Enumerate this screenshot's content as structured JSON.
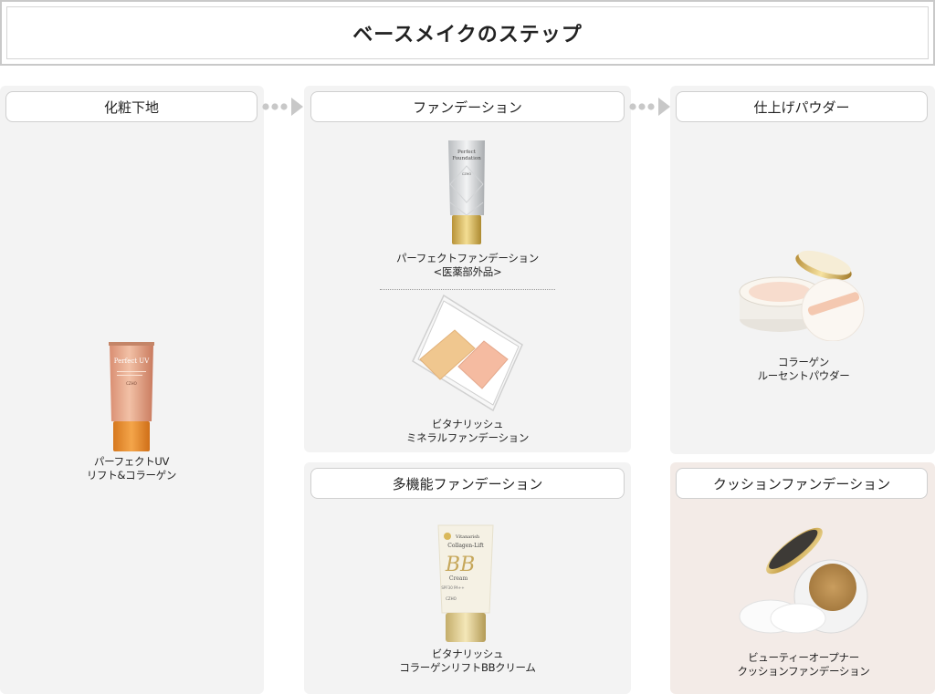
{
  "page": {
    "title": "ベースメイクのステップ"
  },
  "steps": {
    "primer": {
      "label": "化粧下地"
    },
    "foundation": {
      "label": "ファンデーション"
    },
    "powder": {
      "label": "仕上げパウダー"
    },
    "multi_foundation": {
      "label": "多機能ファンデーション"
    },
    "cushion_foundation": {
      "label": "クッションファンデーション"
    }
  },
  "products": {
    "perfect_uv": {
      "line1": "パーフェクトUV",
      "line2": "リフト&コラーゲン",
      "tube_text": "Perfect UV"
    },
    "perfect_foundation": {
      "line1": "パーフェクトファンデーション",
      "line2": "<医薬部外品>",
      "tube_text1": "Perfect",
      "tube_text2": "Foundation",
      "tube_brand": "CZHO"
    },
    "vitanarish_mineral": {
      "line1": "ビタナリッシュ",
      "line2": "ミネラルファンデーション"
    },
    "collagen_powder": {
      "line1": "コラーゲン",
      "line2": "ルーセントパウダー"
    },
    "bb_cream": {
      "line1": "ビタナリッシュ",
      "line2": "コラーゲンリフトBBクリーム",
      "tube_text1": "Collagen-Lift",
      "tube_text2": "BB",
      "tube_text3": "Cream",
      "tube_brand": "CZHO"
    },
    "cushion": {
      "line1": "ビューティーオープナー",
      "line2": "クッションファンデーション"
    }
  },
  "colors": {
    "panel": "#f3f3f3",
    "panel_pink": "#f3ebe7",
    "arrow": "#c8c8c8",
    "gold": "#d8b45a"
  }
}
